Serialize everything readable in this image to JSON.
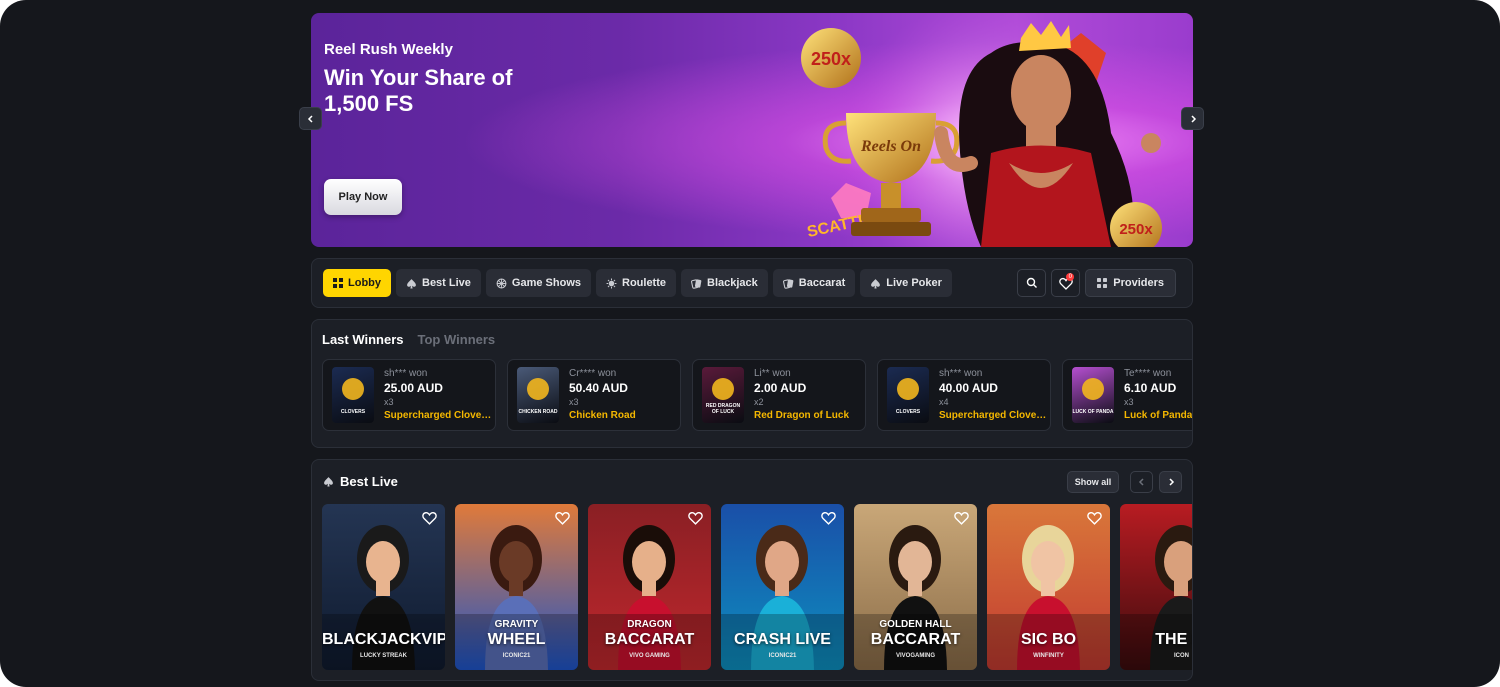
{
  "hero": {
    "kicker": "Reel Rush Weekly",
    "headline": "Win Your Share of 1,500 FS",
    "cta": "Play Now",
    "art": {
      "trophy_text": "Reels On",
      "coin_text": "250x",
      "scatter_text": "SCATTER"
    }
  },
  "nav": {
    "tabs": [
      {
        "label": "Lobby",
        "icon": "grid-icon",
        "active": true
      },
      {
        "label": "Best Live",
        "icon": "spade-icon"
      },
      {
        "label": "Game Shows",
        "icon": "wheel-icon"
      },
      {
        "label": "Roulette",
        "icon": "roulette-icon"
      },
      {
        "label": "Blackjack",
        "icon": "cards-icon"
      },
      {
        "label": "Baccarat",
        "icon": "cards-icon"
      },
      {
        "label": "Live Poker",
        "icon": "spade-icon"
      }
    ],
    "favorites_badge": "0",
    "providers_label": "Providers"
  },
  "winners": {
    "tabs": [
      "Last Winners",
      "Top Winners"
    ],
    "items": [
      {
        "user": "sh*** won",
        "amount": "25.00 AUD",
        "mult": "x3",
        "game": "Supercharged Clover…",
        "thumb_text": "CLOVERS",
        "thumb_color": "#1b2b52"
      },
      {
        "user": "Cr**** won",
        "amount": "50.40 AUD",
        "mult": "x3",
        "game": "Chicken Road",
        "thumb_text": "CHICKEN ROAD",
        "thumb_color": "#4a5a78"
      },
      {
        "user": "Li** won",
        "amount": "2.00 AUD",
        "mult": "x2",
        "game": "Red Dragon of Luck",
        "thumb_text": "RED DRAGON OF LUCK",
        "thumb_color": "#5a1a3a"
      },
      {
        "user": "sh*** won",
        "amount": "40.00 AUD",
        "mult": "x4",
        "game": "Supercharged Clover…",
        "thumb_text": "CLOVERS",
        "thumb_color": "#1b2b52"
      },
      {
        "user": "Te**** won",
        "amount": "6.10 AUD",
        "mult": "x3",
        "game": "Luck of Panda",
        "thumb_text": "LUCK OF PANDA",
        "thumb_color": "#b54fd0"
      }
    ]
  },
  "best_live": {
    "title": "Best Live",
    "show_all": "Show all",
    "games": [
      {
        "sub": "",
        "name": "BLACKJACKVIP",
        "provider": "LUCKY STREAK",
        "bg": "#243553",
        "bg2": "#0f1a2e",
        "skin": "#e8b48f",
        "hair": "#1a1a1a",
        "outfit": "#111111"
      },
      {
        "sub": "GRAVITY",
        "name": "WHEEL",
        "provider": "ICONIC21",
        "bg": "#e07a3a",
        "bg2": "#1e55c9",
        "skin": "#6a3a26",
        "hair": "#3a1a10",
        "outfit": "#5a6fb8"
      },
      {
        "sub": "DRAGON",
        "name": "BACCARAT",
        "provider": "VIVO GAMING",
        "bg": "#8a1f24",
        "bg2": "#c0282d",
        "skin": "#e6b08a",
        "hair": "#1a0d08",
        "outfit": "#c8102e"
      },
      {
        "sub": "",
        "name": "CRASH LIVE",
        "provider": "ICONIC21",
        "bg": "#1a4fa8",
        "bg2": "#0d8fbf",
        "skin": "#e0a787",
        "hair": "#4a2a18",
        "outfit": "#1ab0d8"
      },
      {
        "sub": "GOLDEN HALL",
        "name": "BACCARAT",
        "provider": "VIVOGAMING",
        "bg": "#c9a778",
        "bg2": "#8a6c48",
        "skin": "#e2b696",
        "hair": "#2a1a10",
        "outfit": "#111111"
      },
      {
        "sub": "",
        "name": "SIC BO",
        "provider": "WINFINITY",
        "bg": "#d9773a",
        "bg2": "#c23a30",
        "skin": "#f0c4a4",
        "hair": "#e8d59a",
        "outfit": "#c8102e"
      },
      {
        "sub": "",
        "name": "THE KI",
        "provider": "ICON",
        "bg": "#b81c22",
        "bg2": "#3a0b0d",
        "skin": "#d9a07c",
        "hair": "#2a1a10",
        "outfit": "#1a1a1a"
      }
    ]
  }
}
